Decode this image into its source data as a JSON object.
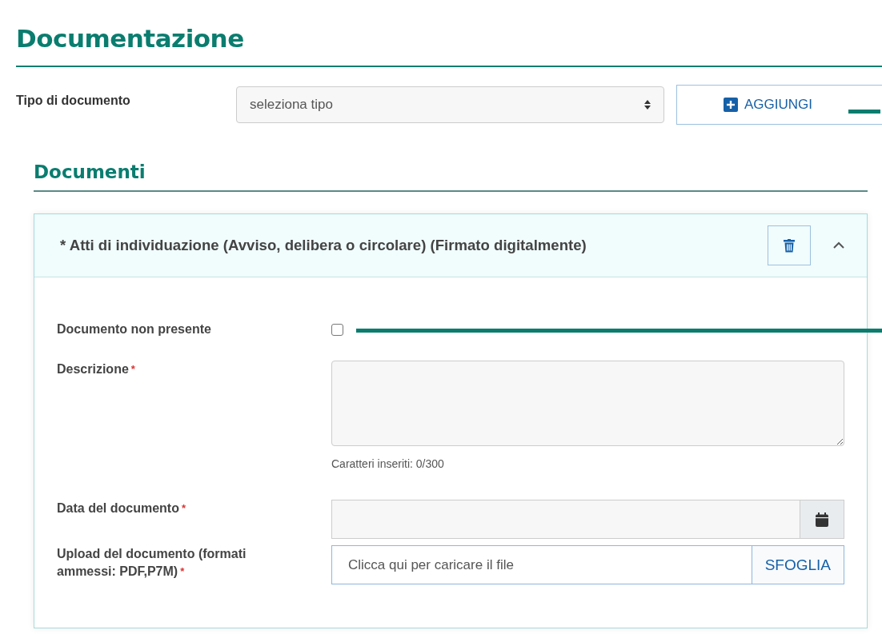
{
  "title": "Documentazione",
  "type_selector": {
    "label": "Tipo di documento",
    "value": "seleziona tipo",
    "add_button": "AGGIUNGI"
  },
  "documents": {
    "heading": "Documenti",
    "items": [
      {
        "title": "* Atti di individuazione (Avviso, delibera o circolare) (Firmato digitalmente)",
        "expanded": true,
        "fields": [
          {
            "kind": "checkbox",
            "label": "Documento non presente",
            "checked": false
          },
          {
            "kind": "textarea",
            "label": "Descrizione",
            "required_mark": "*",
            "counter": "Caratteri inseriti: 0/300"
          },
          {
            "kind": "date",
            "label": "Data del documento",
            "required_mark": "*"
          },
          {
            "kind": "file",
            "label": "Upload del documento (formati ammessi: PDF,P7M)",
            "required_mark": "*",
            "placeholder": "Clicca qui per caricare il file",
            "button": "SFOGLIA"
          }
        ]
      }
    ]
  }
}
